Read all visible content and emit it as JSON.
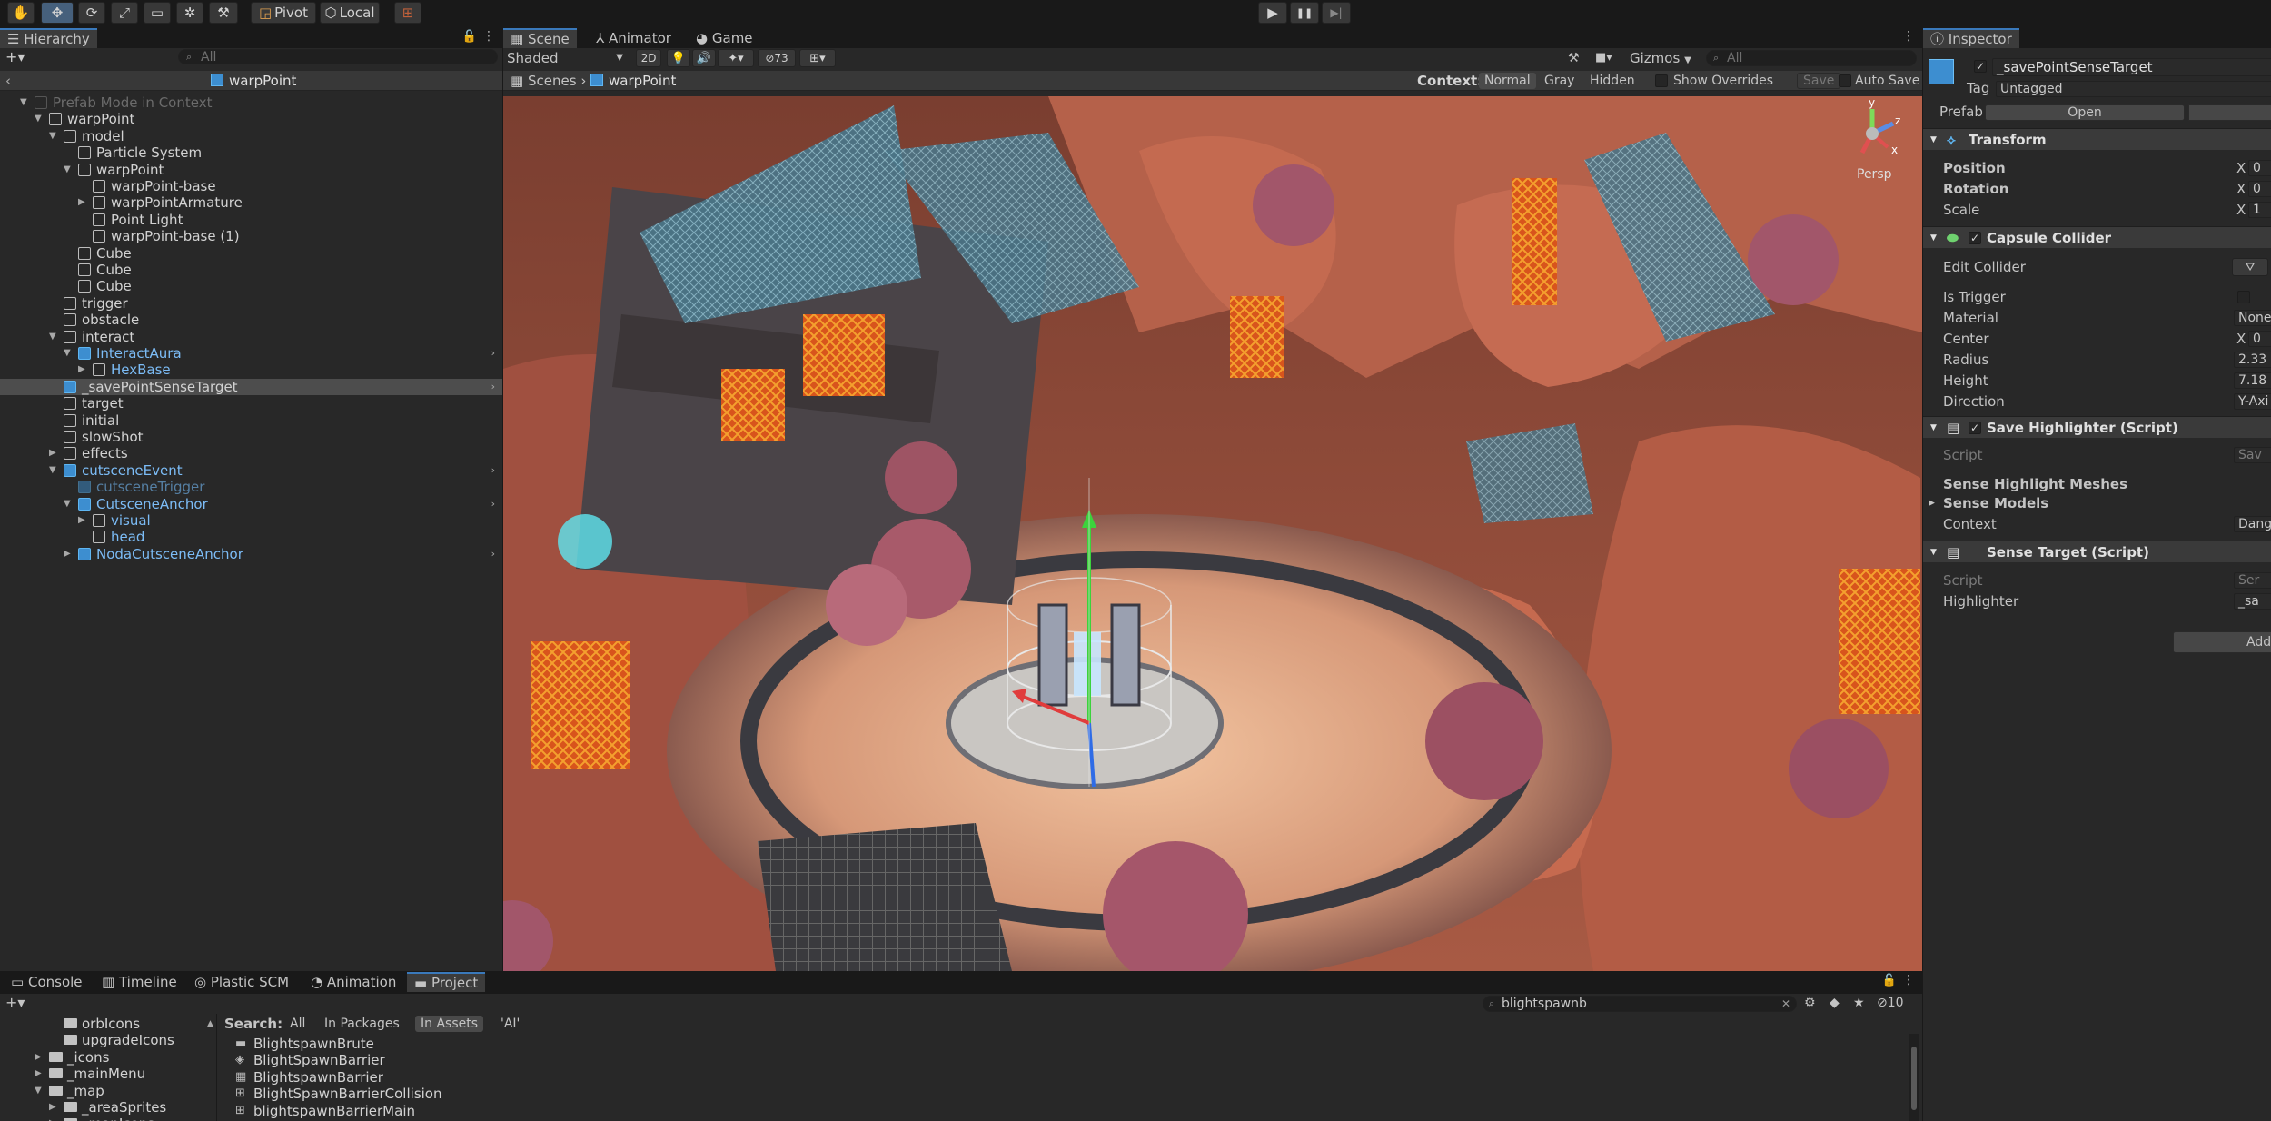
{
  "toolbar": {
    "tools": [
      "hand-icon",
      "move-icon",
      "rotate-icon",
      "rect-icon",
      "scale-icon",
      "transform-icon",
      "custom-icon"
    ],
    "pivot_label": "Pivot",
    "local_label": "Local",
    "play": "▶",
    "pause": "❚❚",
    "step": "▶|"
  },
  "hierarchy": {
    "tab": "Hierarchy",
    "search_placeholder": "All",
    "breadcrumb": "warpPoint",
    "rows": [
      {
        "label": "Prefab Mode in Context",
        "depth": 0,
        "arrow": "▼",
        "icon": "dim",
        "style": "dim"
      },
      {
        "label": "warpPoint",
        "depth": 1,
        "arrow": "▼",
        "icon": "cube",
        "style": ""
      },
      {
        "label": "model",
        "depth": 2,
        "arrow": "▼",
        "icon": "cube",
        "style": ""
      },
      {
        "label": "Particle System",
        "depth": 3,
        "arrow": "",
        "icon": "cube",
        "style": ""
      },
      {
        "label": "warpPoint",
        "depth": 3,
        "arrow": "▼",
        "icon": "cube",
        "style": ""
      },
      {
        "label": "warpPoint-base",
        "depth": 4,
        "arrow": "",
        "icon": "cube",
        "style": ""
      },
      {
        "label": "warpPointArmature",
        "depth": 4,
        "arrow": "▶",
        "icon": "cube",
        "style": ""
      },
      {
        "label": "Point Light",
        "depth": 4,
        "arrow": "",
        "icon": "cube",
        "style": ""
      },
      {
        "label": "warpPoint-base (1)",
        "depth": 4,
        "arrow": "",
        "icon": "cube",
        "style": ""
      },
      {
        "label": "Cube",
        "depth": 3,
        "arrow": "",
        "icon": "cube",
        "style": ""
      },
      {
        "label": "Cube",
        "depth": 3,
        "arrow": "",
        "icon": "cube",
        "style": ""
      },
      {
        "label": "Cube",
        "depth": 3,
        "arrow": "",
        "icon": "cube",
        "style": ""
      },
      {
        "label": "trigger",
        "depth": 2,
        "arrow": "",
        "icon": "cube",
        "style": ""
      },
      {
        "label": "obstacle",
        "depth": 2,
        "arrow": "",
        "icon": "cube",
        "style": ""
      },
      {
        "label": "interact",
        "depth": 2,
        "arrow": "▼",
        "icon": "cube",
        "style": ""
      },
      {
        "label": "InteractAura",
        "depth": 3,
        "arrow": "▼",
        "icon": "blue",
        "style": "blue",
        "more": true
      },
      {
        "label": "HexBase",
        "depth": 4,
        "arrow": "▶",
        "icon": "cube",
        "style": "blue"
      },
      {
        "label": "_savePointSenseTarget",
        "depth": 2,
        "arrow": "",
        "icon": "blue",
        "style": "",
        "selected": true,
        "more": true
      },
      {
        "label": "target",
        "depth": 2,
        "arrow": "",
        "icon": "cube",
        "style": ""
      },
      {
        "label": "initial",
        "depth": 2,
        "arrow": "",
        "icon": "cube",
        "style": ""
      },
      {
        "label": "slowShot",
        "depth": 2,
        "arrow": "",
        "icon": "cube",
        "style": ""
      },
      {
        "label": "effects",
        "depth": 2,
        "arrow": "▶",
        "icon": "cube",
        "style": ""
      },
      {
        "label": "cutsceneEvent",
        "depth": 2,
        "arrow": "▼",
        "icon": "blue",
        "style": "blue",
        "more": true
      },
      {
        "label": "cutsceneTrigger",
        "depth": 3,
        "arrow": "",
        "icon": "dimblue",
        "style": "dimblue"
      },
      {
        "label": "CutsceneAnchor",
        "depth": 3,
        "arrow": "▼",
        "icon": "blue",
        "style": "blue",
        "more": true
      },
      {
        "label": "visual",
        "depth": 4,
        "arrow": "▶",
        "icon": "cube",
        "style": "blue"
      },
      {
        "label": "head",
        "depth": 4,
        "arrow": "",
        "icon": "cube",
        "style": "blue"
      },
      {
        "label": "NodaCutsceneAnchor",
        "depth": 3,
        "arrow": "▶",
        "icon": "blue",
        "style": "blue",
        "more": true
      }
    ]
  },
  "scene": {
    "tabs": [
      "Scene",
      "Animator",
      "Game"
    ],
    "shading": "Shaded",
    "mode_2d": "2D",
    "hidden_count": "73",
    "gizmos_label": "Gizmos",
    "search_placeholder": "All",
    "breadcrumb_root": "Scenes",
    "breadcrumb_item": "warpPoint",
    "context_label": "Context:",
    "context_options": [
      "Normal",
      "Gray",
      "Hidden"
    ],
    "show_overrides": "Show Overrides",
    "save_label": "Save",
    "auto_save": "Auto Save",
    "persp_label": "Persp",
    "axis_y": "y",
    "axis_z": "z",
    "axis_x": "x"
  },
  "inspector": {
    "tab": "Inspector",
    "object_name": "_savePointSenseTarget",
    "tag_label": "Tag",
    "tag_value": "Untagged",
    "prefab_label": "Prefab",
    "open_label": "Open",
    "transform": {
      "title": "Transform",
      "position_label": "Position",
      "position_x": "0",
      "rotation_label": "Rotation",
      "rotation_x": "0",
      "scale_label": "Scale",
      "scale_x": "1"
    },
    "capsule": {
      "title": "Capsule Collider",
      "edit_collider": "Edit Collider",
      "is_trigger": "Is Trigger",
      "material_label": "Material",
      "material_value": "None",
      "center_label": "Center",
      "center_x": "0",
      "radius_label": "Radius",
      "radius_value": "2.33",
      "height_label": "Height",
      "height_value": "7.18",
      "direction_label": "Direction",
      "direction_value": "Y-Axi"
    },
    "save_highlighter": {
      "title": "Save Highlighter (Script)",
      "script_label": "Script",
      "script_value": "Sav",
      "sense_highlight_meshes": "Sense Highlight Meshes",
      "sense_models": "Sense Models",
      "context_label": "Context",
      "context_value": "Dang"
    },
    "sense_target": {
      "title": "Sense Target (Script)",
      "script_label": "Script",
      "script_value": "Ser",
      "highlighter_label": "Highlighter",
      "highlighter_value": "_sa"
    },
    "add_component": "Add C",
    "axis_x": "X"
  },
  "bottom": {
    "tabs": [
      "Console",
      "Timeline",
      "Plastic SCM",
      "Animation",
      "Project"
    ],
    "search_value": "blightspawnb",
    "result_count": "10",
    "search_label": "Search:",
    "filters": [
      "All",
      "In Packages",
      "In Assets",
      "'AI'"
    ],
    "tree": [
      {
        "label": "orbIcons",
        "depth": 2,
        "arrow": ""
      },
      {
        "label": "upgradeIcons",
        "depth": 2,
        "arrow": ""
      },
      {
        "label": "_icons",
        "depth": 1,
        "arrow": "▶"
      },
      {
        "label": "_mainMenu",
        "depth": 1,
        "arrow": "▶"
      },
      {
        "label": "_map",
        "depth": 1,
        "arrow": "▼"
      },
      {
        "label": "_areaSprites",
        "depth": 2,
        "arrow": "▶"
      },
      {
        "label": "_mapIcons",
        "depth": 2,
        "arrow": "▶"
      }
    ],
    "results": [
      {
        "label": "BlightspawnBrute",
        "icon": "folder"
      },
      {
        "label": "BlightSpawnBarrier",
        "icon": "prefab"
      },
      {
        "label": "BlightspawnBarrier",
        "icon": "mesh"
      },
      {
        "label": "BlightSpawnBarrierCollision",
        "icon": "grid"
      },
      {
        "label": "blightspawnBarrierMain",
        "icon": "grid"
      }
    ]
  }
}
